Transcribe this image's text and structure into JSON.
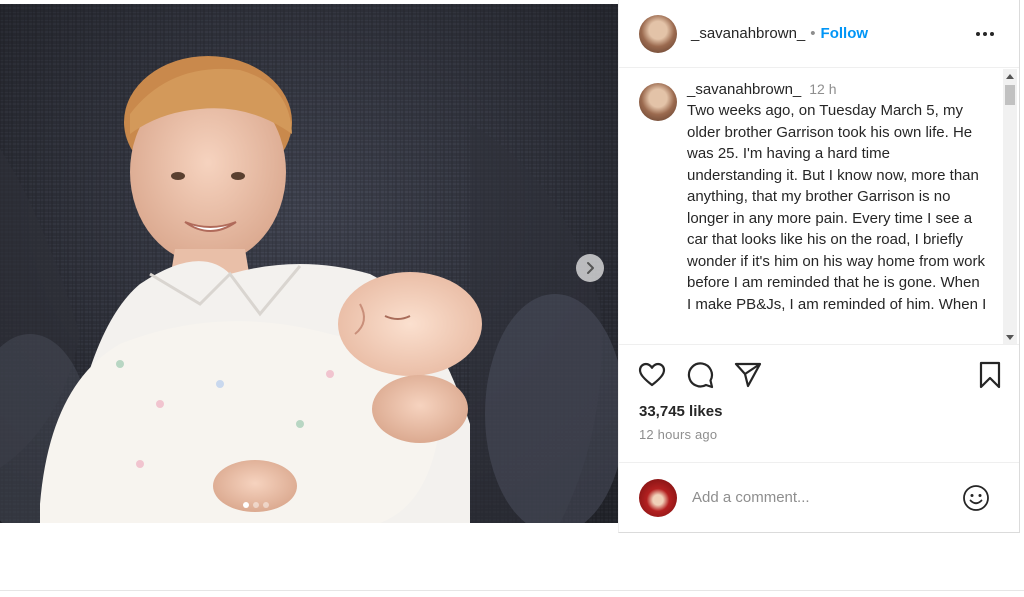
{
  "post": {
    "username": "_savanahbrown_",
    "separator": "•",
    "follow_label": "Follow",
    "caption_time": "12 h",
    "caption": "Two weeks ago, on Tuesday March 5, my older brother Garrison took his own life. He was 25. I'm having a hard time understanding it. But I know now, more than anything, that my brother Garrison is no longer in any more pain. Every time I see a car that looks like his on the road, I briefly wonder if it's him on his way home from work before I am reminded that he is gone. When I make PB&Js, I am reminded of him. When I",
    "likes": "33,745 likes",
    "posted_ago": "12 hours ago",
    "comment_placeholder": "Add a comment..."
  },
  "carousel": {
    "total": 3,
    "current": 1
  },
  "icons": {
    "more": "more-horizontal-icon",
    "like": "heart-icon",
    "comment": "comment-icon",
    "share": "paper-plane-icon",
    "save": "bookmark-icon",
    "emoji": "emoji-smiley-icon",
    "next": "chevron-right-icon"
  },
  "colors": {
    "follow": "#0095f6",
    "muted": "#8e8e8e",
    "text": "#262626"
  }
}
